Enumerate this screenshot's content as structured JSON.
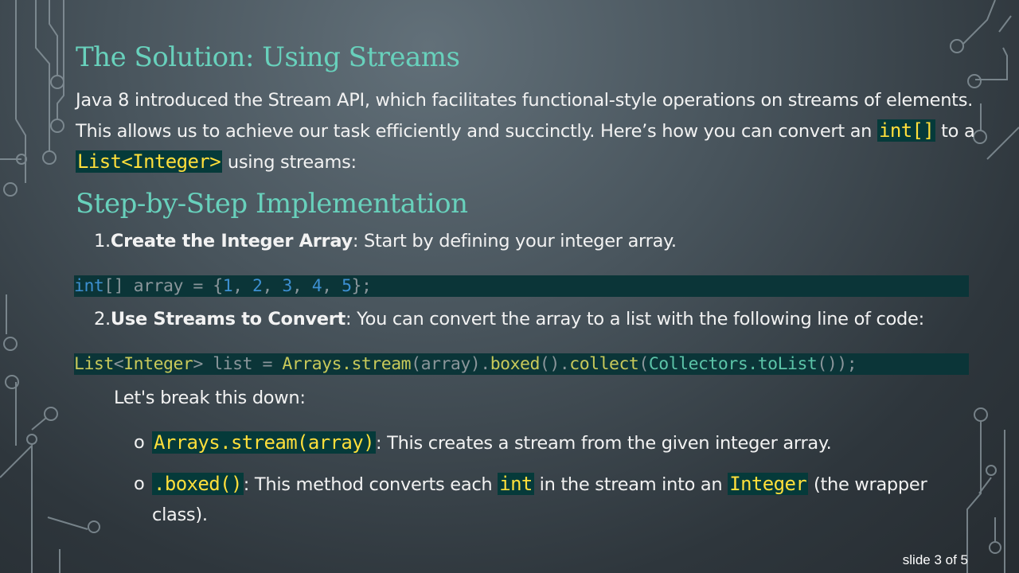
{
  "title": "The Solution: Using Streams",
  "intro": {
    "text_1": "Java 8 introduced the Stream API, which facilitates functional-style operations on streams of elements. This allows us to achieve our task efficiently and succinctly. Here’s how you can convert an ",
    "code_1": "int[]",
    "text_2": " to a ",
    "code_2": "List<Integer>",
    "text_3": " using streams:"
  },
  "subtitle": "Step-by-Step Implementation",
  "steps": [
    {
      "number": "1.",
      "label": "Create the Integer Array",
      "text": ": Start by defining your integer array."
    },
    {
      "number": "2.",
      "label": "Use Streams to Convert",
      "text": ": You can convert the array to a list with the following line of code:"
    }
  ],
  "code_1": {
    "t1": "int",
    "t2": "[] array = {",
    "t3": "1",
    "t4": ", ",
    "t5": "2",
    "t6": ", ",
    "t7": "3",
    "t8": ", ",
    "t9": "4",
    "t10": ", ",
    "t11": "5",
    "t12": "};"
  },
  "code_2": {
    "t1": "List",
    "t2": "<",
    "t3": "Integer",
    "t4": "> list = ",
    "t5": "Arrays.stream",
    "t6": "(array).",
    "t7": "boxed",
    "t8": "().",
    "t9": "collect",
    "t10": "(",
    "t11": "Collectors.toList",
    "t12": "());"
  },
  "breakdown": {
    "lead": "Let's break this down:",
    "items": [
      {
        "bullet": "o",
        "code": "Arrays.stream(array)",
        "text": ": This creates a stream from the given integer array."
      },
      {
        "bullet": "o",
        "code": ".boxed()",
        "text_1": ": This method converts each ",
        "code_2": "int",
        "text_2": " in the stream into an ",
        "code_3": "Integer",
        "text_3": " (the wrapper class)."
      }
    ]
  },
  "footer": "slide 3 of 5",
  "colors": {
    "heading": "#68d1bc",
    "code_highlight": "#ffdf3a",
    "code_background": "#0b3538"
  }
}
